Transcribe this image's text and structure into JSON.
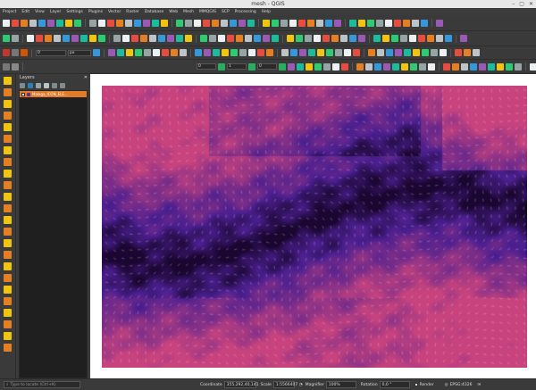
{
  "window": {
    "title": "mesh - QGIS",
    "controls": [
      "–",
      "▢",
      "✕"
    ]
  },
  "menu": [
    "Project",
    "Edit",
    "View",
    "Layer",
    "Settings",
    "Plugins",
    "Vector",
    "Raster",
    "Database",
    "Web",
    "Mesh",
    "MMQGIS",
    "SCP",
    "Processing",
    "Help"
  ],
  "toolbar": {
    "snap_tolerance": "0",
    "snap_unit": "px",
    "digit_a": "0",
    "digit_b": "1",
    "digit_c": "0"
  },
  "layers_panel": {
    "title": "Layers",
    "items": [
      {
        "name": "Malaga_ICON_ELE...",
        "checked": true
      }
    ]
  },
  "status": {
    "locator_placeholder": "Type to locate (Ctrl+K)",
    "coordinate_label": "Coordinate",
    "coordinate": "355,292,40,141",
    "scale_label": "Scale",
    "scale": "1:5566407",
    "magnifier_label": "Magnifier",
    "magnifier": "100%",
    "rotation_label": "Rotation",
    "rotation": "0,0 °",
    "render_label": "Render",
    "crs": "EPSG:4326"
  },
  "colors": {
    "accent": "#e07b28",
    "mesh_low": "#1a0630",
    "mesh_mid": "#4b1f8f",
    "mesh_high": "#c8437e"
  },
  "icons": [
    "new-project-icon",
    "open-icon",
    "save-icon",
    "pan-icon",
    "zoom-in-icon",
    "zoom-out-icon",
    "identify-icon",
    "select-icon",
    "measure-icon",
    "digitize-icon"
  ]
}
